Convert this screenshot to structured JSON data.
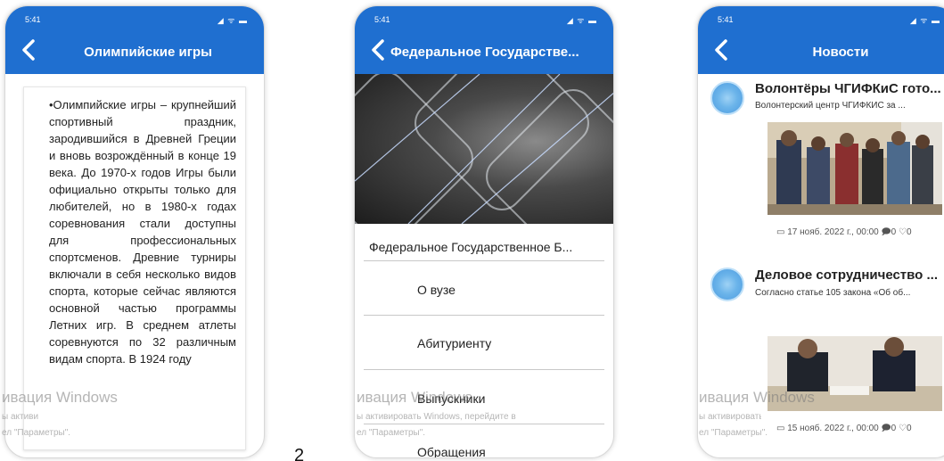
{
  "status": {
    "time": "5:41",
    "icons": "◢ ᯤ ▬"
  },
  "screen1": {
    "title": "Олимпийские игры",
    "body": "•Олимпийские игры – крупнейший спортивный праздник, зародившийся в Древней Греции и вновь возрождённый в конце 19 века. До 1970-х годов Игры были официально открыты только для любителей, но в 1980-х годах соревнования стали доступны для профессиональных спортсменов. Древние турниры включали в себя несколько видов спорта, которые сейчас являются основной частью программы Летних игр. В среднем атлеты соревнуются по 32 различным видам спорта. В 1924 году"
  },
  "screen2": {
    "title": "Федеральное Государстве...",
    "university": "Федеральное Государственное Б...",
    "menu": [
      "О вузе",
      "Абитуриенту",
      "Выпускники",
      "Обращения"
    ]
  },
  "screen3": {
    "title": "Новости",
    "news": [
      {
        "title": "Волонтёры ЧГИФКиС гото...",
        "subtitle": "Волонтерский центр ЧГИФКИС за ...",
        "meta": "17 нояб. 2022 г., 00:00",
        "comments": "0",
        "likes": "0"
      },
      {
        "title": "Деловое сотрудничество ...",
        "subtitle": "Согласно статье 105 закона «Об об...",
        "meta": "15 нояб. 2022 г., 00:00",
        "comments": "0",
        "likes": "0"
      }
    ]
  },
  "watermark": {
    "line1": "ивация Windows",
    "line2_a": "ы активировать Windows, перейдите в",
    "line3": "ел \"Параметры\".",
    "line2_c": "ы активировать Windows, перейдите в"
  },
  "page_number": "2",
  "icons": {
    "back": "chevron-left-icon",
    "calendar": "calendar-icon",
    "comment": "comment-icon",
    "like": "heart-icon"
  },
  "colors": {
    "appbar": "#1f6fd0",
    "text": "#222222",
    "avatar": "#6bb4ea"
  }
}
